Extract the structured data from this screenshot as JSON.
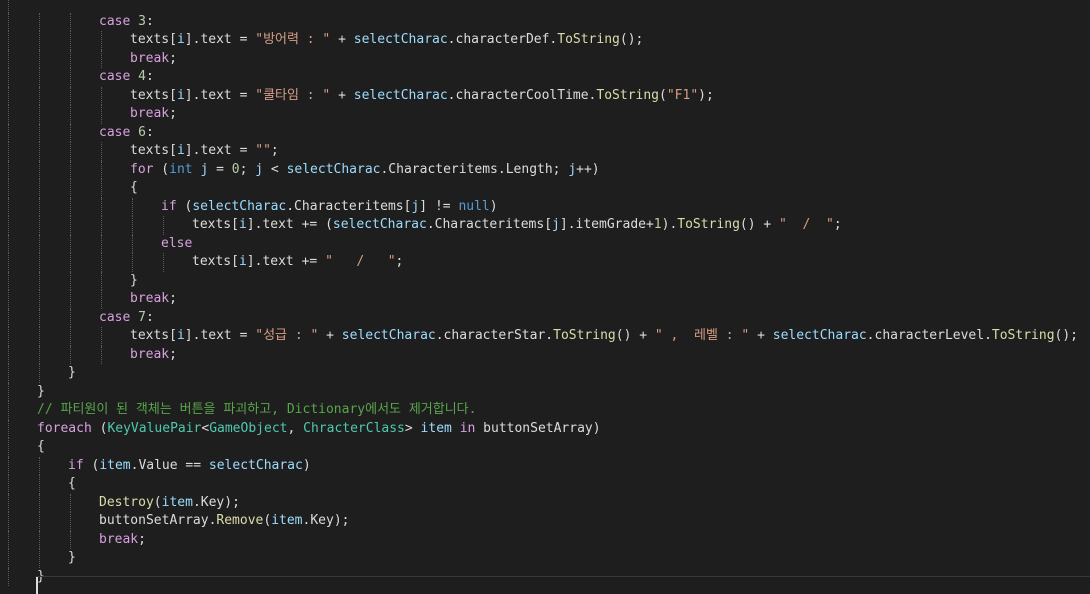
{
  "editor": {
    "lines": [
      {
        "indent": 0,
        "tokens": []
      },
      {
        "indent": 2,
        "tokens": [
          {
            "t": "case",
            "c": "ctl"
          },
          {
            "t": " "
          },
          {
            "t": "3",
            "c": "num"
          },
          {
            "t": ":"
          }
        ]
      },
      {
        "indent": 3,
        "tokens": [
          {
            "t": "texts"
          },
          {
            "t": "["
          },
          {
            "t": "i",
            "c": "var"
          },
          {
            "t": "].text = "
          },
          {
            "t": "\"방어력 : \"",
            "c": "str"
          },
          {
            "t": " + "
          },
          {
            "t": "selectCharac",
            "c": "var"
          },
          {
            "t": ".characterDef."
          },
          {
            "t": "ToString",
            "c": "method"
          },
          {
            "t": "();"
          }
        ]
      },
      {
        "indent": 3,
        "tokens": [
          {
            "t": "break",
            "c": "ctl"
          },
          {
            "t": ";"
          }
        ]
      },
      {
        "indent": 2,
        "tokens": [
          {
            "t": "case",
            "c": "ctl"
          },
          {
            "t": " "
          },
          {
            "t": "4",
            "c": "num"
          },
          {
            "t": ":"
          }
        ]
      },
      {
        "indent": 3,
        "tokens": [
          {
            "t": "texts"
          },
          {
            "t": "["
          },
          {
            "t": "i",
            "c": "var"
          },
          {
            "t": "].text = "
          },
          {
            "t": "\"쿨타임 : \"",
            "c": "str"
          },
          {
            "t": " + "
          },
          {
            "t": "selectCharac",
            "c": "var"
          },
          {
            "t": ".characterCoolTime."
          },
          {
            "t": "ToString",
            "c": "method"
          },
          {
            "t": "("
          },
          {
            "t": "\"F1\"",
            "c": "str"
          },
          {
            "t": ");"
          }
        ]
      },
      {
        "indent": 3,
        "tokens": [
          {
            "t": "break",
            "c": "ctl"
          },
          {
            "t": ";"
          }
        ]
      },
      {
        "indent": 2,
        "tokens": [
          {
            "t": "case",
            "c": "ctl"
          },
          {
            "t": " "
          },
          {
            "t": "6",
            "c": "num"
          },
          {
            "t": ":"
          }
        ]
      },
      {
        "indent": 3,
        "tokens": [
          {
            "t": "texts"
          },
          {
            "t": "["
          },
          {
            "t": "i",
            "c": "var"
          },
          {
            "t": "].text = "
          },
          {
            "t": "\"\"",
            "c": "str"
          },
          {
            "t": ";"
          }
        ]
      },
      {
        "indent": 3,
        "tokens": [
          {
            "t": "for",
            "c": "ctl"
          },
          {
            "t": " ("
          },
          {
            "t": "int",
            "c": "kw"
          },
          {
            "t": " "
          },
          {
            "t": "j",
            "c": "var"
          },
          {
            "t": " = "
          },
          {
            "t": "0",
            "c": "num"
          },
          {
            "t": "; "
          },
          {
            "t": "j",
            "c": "var"
          },
          {
            "t": " < "
          },
          {
            "t": "selectCharac",
            "c": "var"
          },
          {
            "t": ".Characteritems.Length; "
          },
          {
            "t": "j",
            "c": "var"
          },
          {
            "t": "++)"
          }
        ]
      },
      {
        "indent": 3,
        "tokens": [
          {
            "t": "{"
          }
        ]
      },
      {
        "indent": 4,
        "tokens": [
          {
            "t": "if",
            "c": "ctl"
          },
          {
            "t": " ("
          },
          {
            "t": "selectCharac",
            "c": "var"
          },
          {
            "t": ".Characteritems["
          },
          {
            "t": "j",
            "c": "var"
          },
          {
            "t": "] != "
          },
          {
            "t": "null",
            "c": "kw"
          },
          {
            "t": ")"
          }
        ]
      },
      {
        "indent": 5,
        "tokens": [
          {
            "t": "texts"
          },
          {
            "t": "["
          },
          {
            "t": "i",
            "c": "var"
          },
          {
            "t": "].text += ("
          },
          {
            "t": "selectCharac",
            "c": "var"
          },
          {
            "t": ".Characteritems["
          },
          {
            "t": "j",
            "c": "var"
          },
          {
            "t": "].itemGrade+"
          },
          {
            "t": "1",
            "c": "num"
          },
          {
            "t": ")."
          },
          {
            "t": "ToString",
            "c": "method"
          },
          {
            "t": "() + "
          },
          {
            "t": "\"  /  \"",
            "c": "str"
          },
          {
            "t": ";"
          }
        ]
      },
      {
        "indent": 4,
        "tokens": [
          {
            "t": "else",
            "c": "ctl"
          }
        ]
      },
      {
        "indent": 5,
        "tokens": [
          {
            "t": "texts"
          },
          {
            "t": "["
          },
          {
            "t": "i",
            "c": "var"
          },
          {
            "t": "].text += "
          },
          {
            "t": "\"   /   \"",
            "c": "str"
          },
          {
            "t": ";"
          }
        ]
      },
      {
        "indent": 3,
        "tokens": [
          {
            "t": "}"
          }
        ]
      },
      {
        "indent": 3,
        "tokens": [
          {
            "t": "break",
            "c": "ctl"
          },
          {
            "t": ";"
          }
        ]
      },
      {
        "indent": 2,
        "tokens": [
          {
            "t": "case",
            "c": "ctl"
          },
          {
            "t": " "
          },
          {
            "t": "7",
            "c": "num"
          },
          {
            "t": ":"
          }
        ]
      },
      {
        "indent": 3,
        "tokens": [
          {
            "t": "texts"
          },
          {
            "t": "["
          },
          {
            "t": "i",
            "c": "var"
          },
          {
            "t": "].text = "
          },
          {
            "t": "\"성급 : \"",
            "c": "str"
          },
          {
            "t": " + "
          },
          {
            "t": "selectCharac",
            "c": "var"
          },
          {
            "t": ".characterStar."
          },
          {
            "t": "ToString",
            "c": "method"
          },
          {
            "t": "() + "
          },
          {
            "t": "\" ,  레벨 : \"",
            "c": "str"
          },
          {
            "t": " + "
          },
          {
            "t": "selectCharac",
            "c": "var"
          },
          {
            "t": ".characterLevel."
          },
          {
            "t": "ToString",
            "c": "method"
          },
          {
            "t": "();"
          }
        ]
      },
      {
        "indent": 3,
        "tokens": [
          {
            "t": "break",
            "c": "ctl"
          },
          {
            "t": ";"
          }
        ]
      },
      {
        "indent": 1,
        "tokens": [
          {
            "t": "}"
          }
        ]
      },
      {
        "indent": 0,
        "tokens": [
          {
            "t": "}"
          }
        ]
      },
      {
        "indent": 0,
        "tokens": [
          {
            "t": "// 파티원이 된 객체는 버튼을 파괴하고, Dictionary에서도 제거합니다.",
            "c": "cmt"
          }
        ]
      },
      {
        "indent": 0,
        "tokens": [
          {
            "t": "foreach",
            "c": "ctl"
          },
          {
            "t": " ("
          },
          {
            "t": "KeyValuePair",
            "c": "type"
          },
          {
            "t": "<"
          },
          {
            "t": "GameObject",
            "c": "type"
          },
          {
            "t": ", "
          },
          {
            "t": "ChracterClass",
            "c": "type"
          },
          {
            "t": "> "
          },
          {
            "t": "item",
            "c": "var"
          },
          {
            "t": " "
          },
          {
            "t": "in",
            "c": "ctl"
          },
          {
            "t": " buttonSetArray)"
          }
        ]
      },
      {
        "indent": 0,
        "tokens": [
          {
            "t": "{"
          }
        ]
      },
      {
        "indent": 1,
        "tokens": [
          {
            "t": "if",
            "c": "ctl"
          },
          {
            "t": " ("
          },
          {
            "t": "item",
            "c": "var"
          },
          {
            "t": ".Value == "
          },
          {
            "t": "selectCharac",
            "c": "var"
          },
          {
            "t": ")"
          }
        ]
      },
      {
        "indent": 1,
        "tokens": [
          {
            "t": "{"
          }
        ]
      },
      {
        "indent": 2,
        "tokens": [
          {
            "t": "Destroy",
            "c": "method"
          },
          {
            "t": "("
          },
          {
            "t": "item",
            "c": "var"
          },
          {
            "t": ".Key);"
          }
        ]
      },
      {
        "indent": 2,
        "tokens": [
          {
            "t": "buttonSetArray."
          },
          {
            "t": "Remove",
            "c": "method"
          },
          {
            "t": "("
          },
          {
            "t": "item",
            "c": "var"
          },
          {
            "t": ".Key);"
          }
        ]
      },
      {
        "indent": 2,
        "tokens": [
          {
            "t": "break",
            "c": "ctl"
          },
          {
            "t": ";"
          }
        ]
      },
      {
        "indent": 1,
        "tokens": [
          {
            "t": "}"
          }
        ]
      },
      {
        "indent": 0,
        "tokens": [
          {
            "t": "}"
          }
        ]
      }
    ]
  },
  "colors": {
    "background": "#1e1e1e",
    "keyword": "#569cd6",
    "control": "#d8a0df",
    "string": "#d69d85",
    "number": "#b5cea8",
    "comment": "#57a64a",
    "type": "#4ec9b0",
    "method": "#dcdcaa",
    "variable": "#9cdcfe",
    "plain": "#dcdcdc"
  }
}
